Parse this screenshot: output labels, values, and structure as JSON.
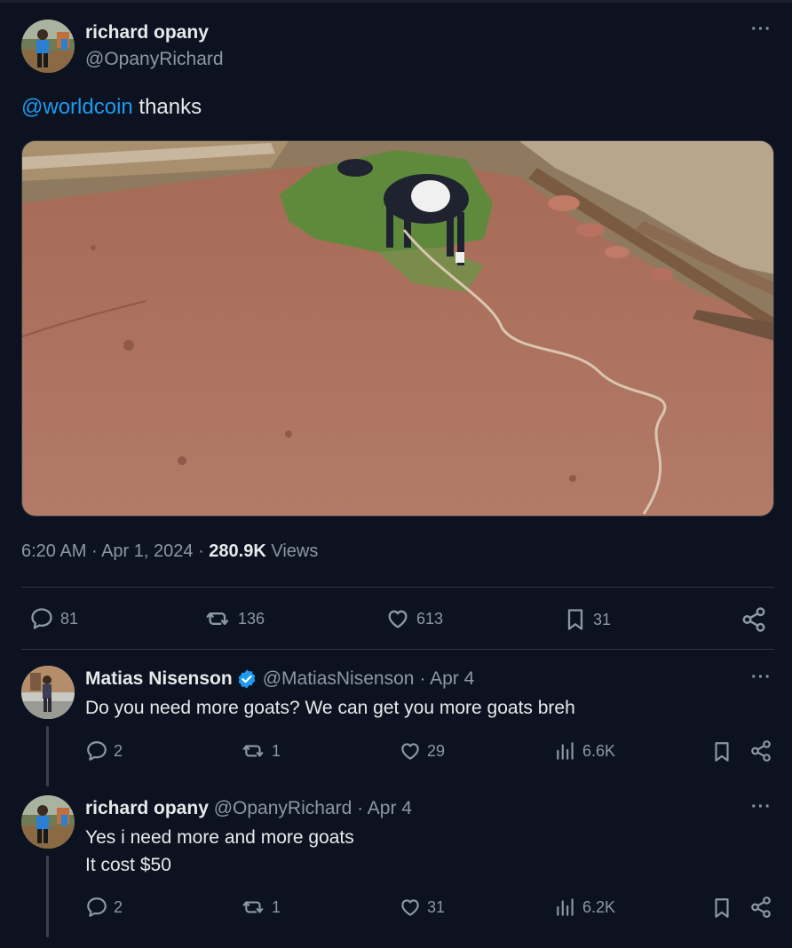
{
  "main_tweet": {
    "author_name": "richard opany",
    "author_handle": "@OpanyRichard",
    "mention": "@worldcoin",
    "text_after_mention": " thanks",
    "time": "6:20 AM",
    "sep1": "·",
    "date": "Apr 1, 2024",
    "sep2": "·",
    "views_count": "280.9K",
    "views_label": "Views",
    "replies": "81",
    "retweets": "136",
    "likes": "613",
    "bookmarks": "31"
  },
  "replies": [
    {
      "author_name": "Matias Nisenson",
      "author_handle": "@MatiasNisenson",
      "date": "· Apr 4",
      "lines": [
        "Do you need more goats? We can get you more goats breh"
      ],
      "replies": "2",
      "retweets": "1",
      "likes": "29",
      "views": "6.6K"
    },
    {
      "author_name": "richard opany",
      "author_handle": "@OpanyRichard",
      "date": "· Apr 4",
      "lines": [
        "Yes i need more and more goats",
        "It cost $50"
      ],
      "replies": "2",
      "retweets": "1",
      "likes": "31",
      "views": "6.2K"
    }
  ],
  "colors": {
    "background": "#0d1220",
    "link": "#1d9bf0",
    "verified": "#1d9bf0",
    "muted": "#8b98a5"
  },
  "icons": [
    "reply-icon",
    "retweet-icon",
    "like-icon",
    "bookmark-icon",
    "share-icon",
    "views-icon",
    "verified-badge-icon",
    "more-icon"
  ]
}
